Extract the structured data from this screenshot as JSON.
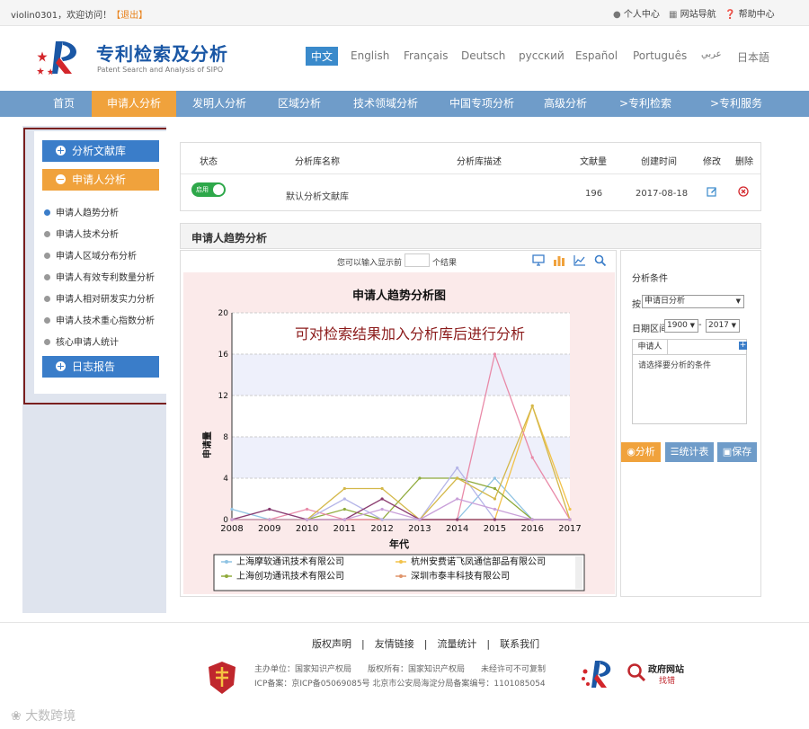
{
  "topbar": {
    "welcome": "violin0301，欢迎访问！",
    "logout": "【退出】",
    "links": [
      "个人中心",
      "网站导航",
      "帮助中心"
    ]
  },
  "header": {
    "title": "专利检索及分析",
    "subtitle": "Patent Search and Analysis of SIPO",
    "languages": [
      "中文",
      "English",
      "Français",
      "Deutsch",
      "русский",
      "Español",
      "Português",
      "عربي",
      "日本語"
    ]
  },
  "nav": {
    "items": [
      "首页",
      "申请人分析",
      "发明人分析",
      "区域分析",
      "技术领域分析",
      "中国专项分析",
      "高级分析",
      ">专利检索",
      ">专利服务"
    ],
    "active_index": 1
  },
  "sidebar": {
    "library_btn": "分析文献库",
    "applicant_btn": "申请人分析",
    "sub_items": [
      "申请人趋势分析",
      "申请人技术分析",
      "申请人区域分布分析",
      "申请人有效专利数量分析",
      "申请人相对研发实力分析",
      "申请人技术重心指数分析",
      "核心申请人统计"
    ],
    "log_btn": "日志报告"
  },
  "library_table": {
    "headers": [
      "状态",
      "分析库名称",
      "分析库描述",
      "文献量",
      "创建时间",
      "修改",
      "删除"
    ],
    "row": {
      "status": "启用",
      "name": "默认分析文献库",
      "description": "",
      "count": "196",
      "created": "2017-08-18"
    }
  },
  "section": {
    "title": "申请人趋势分析",
    "prompt_before": "您可以输入显示前",
    "prompt_after": "个结果"
  },
  "annotation": "可对检索结果加入分析库后进行分析",
  "chart_data": {
    "type": "line",
    "title": "申请人趋势分析图",
    "xlabel": "年代",
    "ylabel": "申请量",
    "x": [
      2008,
      2009,
      2010,
      2011,
      2012,
      2013,
      2014,
      2015,
      2016,
      2017
    ],
    "ylim": [
      0,
      20
    ],
    "yticks": [
      0,
      4,
      8,
      12,
      16,
      20
    ],
    "grid": true,
    "series": [
      {
        "name": "上海摩软通讯技术有限公司",
        "color": "#8fc3e3",
        "values": [
          1,
          0,
          0,
          0,
          0,
          0,
          0,
          4,
          0,
          0
        ]
      },
      {
        "name": "杭州安费诺飞凤通信部品有限公司",
        "color": "#f2c24a",
        "values": [
          0,
          0,
          0,
          0,
          0,
          0,
          0,
          0,
          11,
          1
        ]
      },
      {
        "name": "上海创功通讯技术有限公司",
        "color": "#8faa3b",
        "values": [
          0,
          0,
          0,
          1,
          0,
          4,
          4,
          3,
          0,
          0
        ]
      },
      {
        "name": "深圳市泰丰科技有限公司",
        "color": "#e0946b",
        "values": [
          0,
          0,
          0,
          0,
          0,
          0,
          0,
          0,
          0,
          0
        ]
      },
      {
        "name": "",
        "color": "#e98aa8",
        "values": [
          0,
          0,
          1,
          0,
          0,
          0,
          0,
          16,
          6,
          0
        ]
      },
      {
        "name": "",
        "color": "#b5b5e8",
        "values": [
          0,
          1,
          0,
          2,
          0,
          0,
          5,
          0,
          0,
          0
        ]
      },
      {
        "name": "",
        "color": "#d4b84a",
        "values": [
          0,
          0,
          0,
          3,
          3,
          0,
          4,
          2,
          11,
          0
        ]
      },
      {
        "name": "",
        "color": "#8a3b6e",
        "values": [
          0,
          1,
          0,
          0,
          2,
          0,
          0,
          0,
          0,
          0
        ]
      },
      {
        "name": "",
        "color": "#c9a0d9",
        "values": [
          0,
          0,
          0,
          0,
          1,
          0,
          2,
          1,
          0,
          0
        ]
      }
    ],
    "legend_placement": "bottom"
  },
  "right_panel": {
    "title": "分析条件",
    "by_label": "按",
    "by_value": "申请日分析",
    "date_label": "日期区间",
    "date_from": "1900",
    "date_sep": "-",
    "date_to": "2017",
    "tab_label": "申请人",
    "placeholder": "请选择要分析的条件",
    "buttons": [
      "分析",
      "统计表",
      "保存"
    ]
  },
  "footer": {
    "links": [
      "版权声明",
      "友情链接",
      "流量统计",
      "联系我们"
    ],
    "line1": "主办单位：国家知识产权局　　版权所有：国家知识产权局　　未经许可不可复制",
    "line2": "ICP备案：京ICP备05069085号 北京市公安局海淀分局备案编号：1101085054",
    "gov_badge_top": "政府网站",
    "gov_badge_bottom": "找错",
    "watermark": "大数跨境"
  },
  "colors": {
    "nav": "#6f9cc9",
    "accent": "#f0a23c",
    "blue_btn": "#3a7dc9",
    "highlight_frame": "#7a1f1f"
  }
}
